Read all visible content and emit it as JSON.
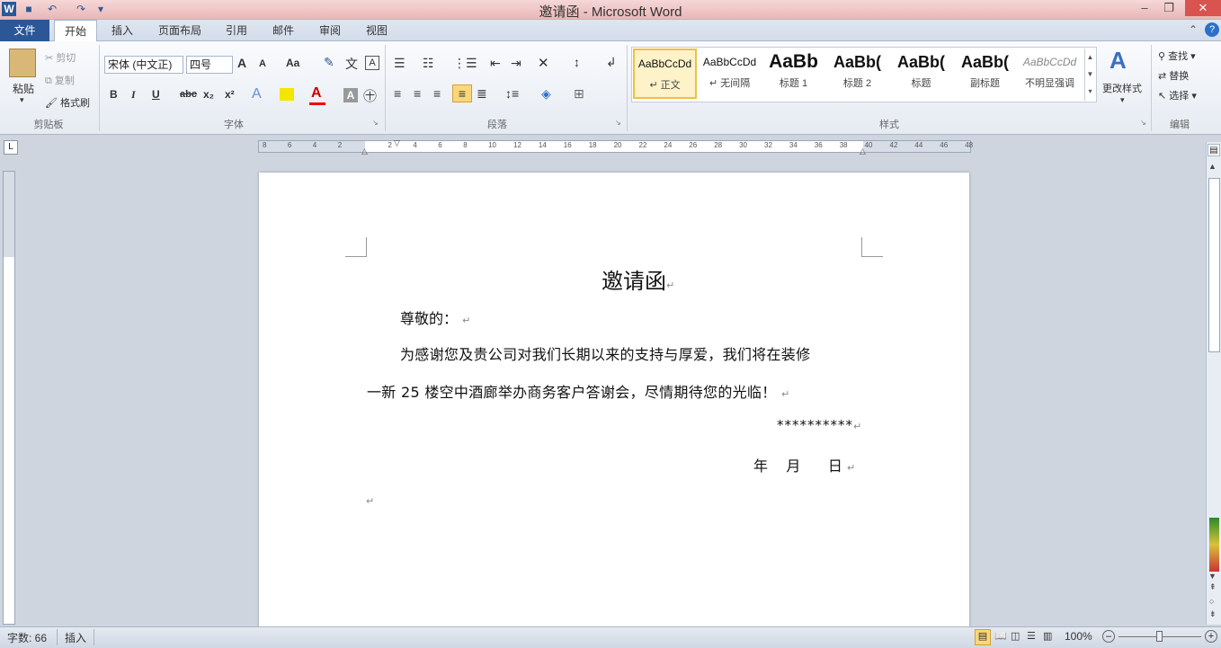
{
  "window": {
    "title": "邀请函 - Microsoft Word"
  },
  "quick_access": {
    "app_icon": "word-icon",
    "save_icon": "save-icon",
    "undo_icon": "undo-icon",
    "redo_icon": "redo-icon"
  },
  "tabs": [
    "文件",
    "开始",
    "插入",
    "页面布局",
    "引用",
    "邮件",
    "审阅",
    "视图"
  ],
  "ribbon": {
    "clipboard": {
      "paste": "粘贴",
      "cut": "剪切",
      "copy": "复制",
      "format_painter": "格式刷",
      "group": "剪贴板"
    },
    "font": {
      "font_name": "宋体 (中文正)",
      "font_size": "四号",
      "grow": "A",
      "shrink": "A",
      "case": "Aa",
      "clear": "A",
      "bold": "B",
      "italic": "I",
      "underline": "U",
      "strike": "abc",
      "sub": "x₂",
      "sup": "x²",
      "color": "A",
      "group": "字体"
    },
    "paragraph": {
      "group": "段落"
    },
    "styles": {
      "items": [
        {
          "preview": "AaBbCcDd",
          "name": "↵ 正文"
        },
        {
          "preview": "AaBbCcDd",
          "name": "↵ 无间隔"
        },
        {
          "preview": "AaBb",
          "name": "标题 1"
        },
        {
          "preview": "AaBb(",
          "name": "标题 2"
        },
        {
          "preview": "AaBb(",
          "name": "标题"
        },
        {
          "preview": "AaBb(",
          "name": "副标题"
        },
        {
          "preview": "AaBbCcDd",
          "name": "不明显强调"
        }
      ],
      "change_styles": "更改样式",
      "group": "样式"
    },
    "editing": {
      "find": "查找",
      "replace": "替换",
      "select": "选择",
      "group": "编辑"
    }
  },
  "ruler": {
    "ticks": [
      "8",
      "6",
      "4",
      "2",
      "",
      "2",
      "4",
      "6",
      "8",
      "10",
      "12",
      "14",
      "16",
      "18",
      "20",
      "22",
      "24",
      "26",
      "28",
      "30",
      "32",
      "34",
      "36",
      "38",
      "40",
      "42",
      "44",
      "46",
      "48"
    ]
  },
  "document": {
    "title": "邀请函",
    "salutation": "尊敬的：",
    "body_line1": "为感谢您及贵公司对我们长期以来的支持与厚爱，我们将在装修",
    "body_line2": "一新 25 楼空中酒廊举办商务客户答谢会，尽情期待您的光临！",
    "signature": "**********",
    "date": "年    月      日"
  },
  "status": {
    "word_count": "字数: 66",
    "mode": "插入",
    "zoom": "100%"
  }
}
